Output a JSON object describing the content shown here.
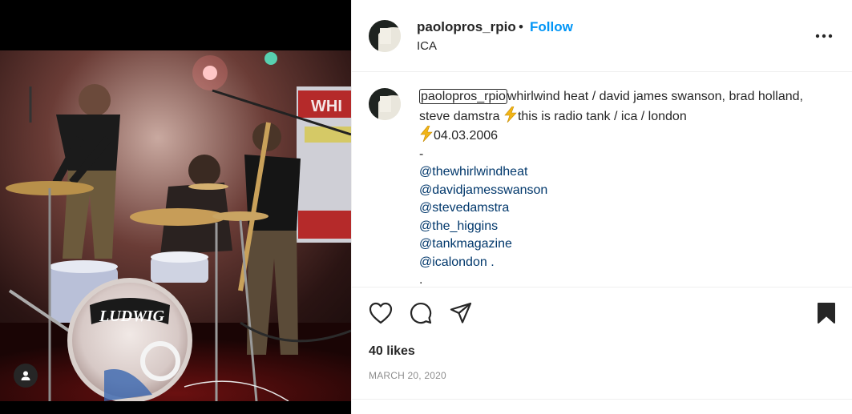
{
  "post": {
    "username": "paolopros_rpio",
    "separator": "•",
    "follow_label": "Follow",
    "location": "ICA",
    "photo_drum_text": "LUDWIG",
    "photo_banner_text": "WHI"
  },
  "caption": {
    "username": "paolopros_rpio",
    "line1": "whirlwind heat / david james swanson, brad holland, steve damstra ",
    "line1b": "this is radio tank / ica / london",
    "line2": "04.03.2006",
    "dash": "-",
    "mentions": [
      "@thewhirlwindheat",
      "@davidjamesswanson",
      "@stevedamstra",
      "@the_higgins",
      "@tankmagazine",
      "@icalondon ."
    ],
    "trailing": "."
  },
  "stats": {
    "likes": "40 likes",
    "date": "MARCH 20, 2020"
  },
  "icons": {
    "like": "heart-icon",
    "comment": "comment-icon",
    "share": "paper-plane-icon",
    "save": "bookmark-icon",
    "more": "more-icon",
    "user_tag": "user-icon",
    "emoji": "lightning-icon"
  },
  "colors": {
    "follow": "#0095f6",
    "mention": "#00376b",
    "text": "#262626",
    "muted": "#8e8e8e"
  }
}
